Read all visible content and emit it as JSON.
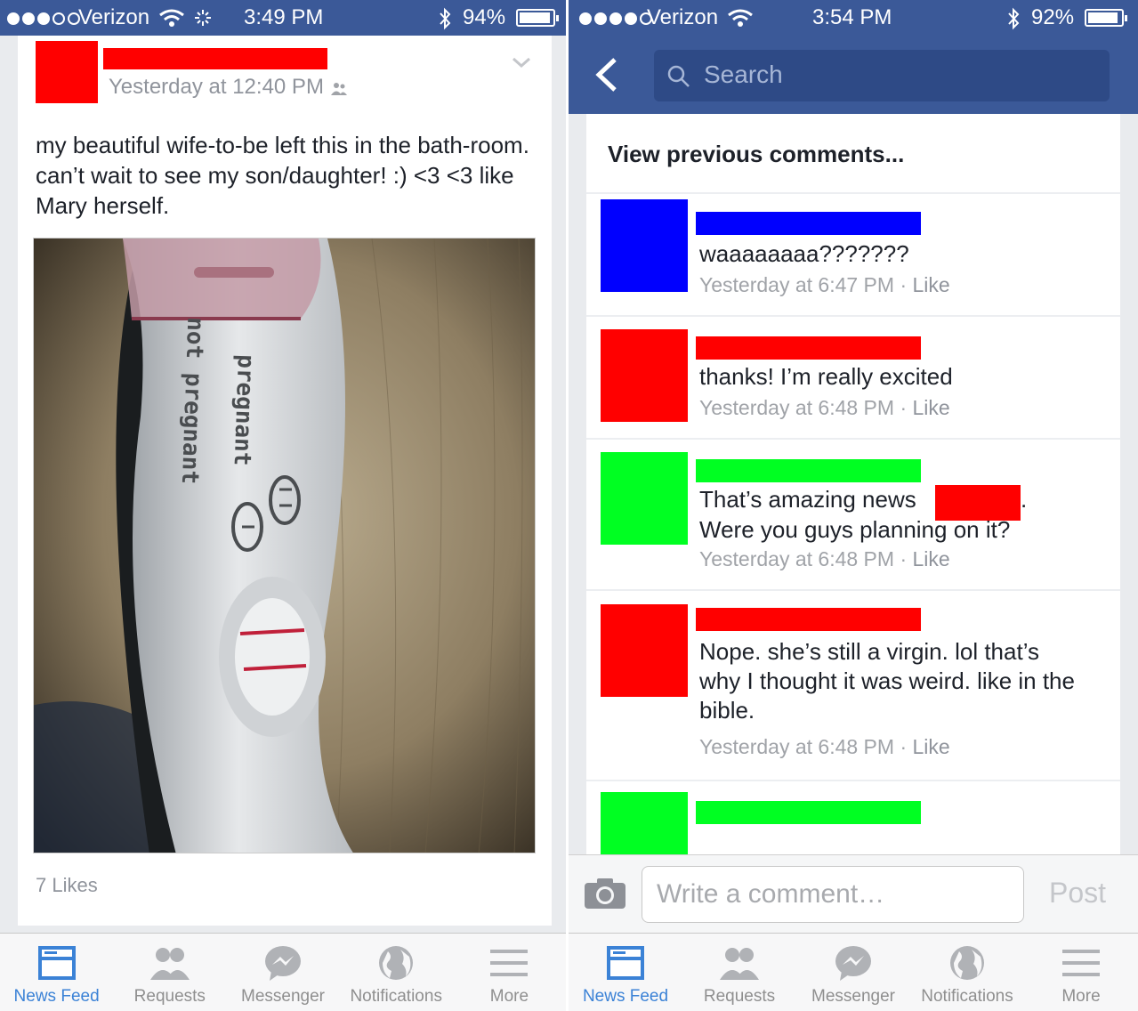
{
  "left": {
    "status": {
      "carrier": "Verizon",
      "time": "3:49 PM",
      "battery": "94%",
      "battery_level": 0.94
    },
    "post": {
      "time": "Yesterday at 12:40 PM",
      "text": "my beautiful wife-to-be left this in the bath-room. can’t wait to see my son/daughter! :) <3 <3 like Mary herself.",
      "photo_labels": {
        "pregnant": "pregnant",
        "not_pregnant": "not pregnant"
      },
      "likes": "7 Likes"
    }
  },
  "right": {
    "status": {
      "carrier": "Verizon",
      "time": "3:54 PM",
      "battery": "92%",
      "battery_level": 0.92
    },
    "search_placeholder": "Search",
    "view_previous": "View previous comments...",
    "comments": [
      {
        "text": "waaaaaaaa???????",
        "time": "Yesterday at 6:47 PM",
        "like": "Like",
        "color": "#0000ff"
      },
      {
        "text": "thanks! I’m really excited",
        "time": "Yesterday at 6:48 PM",
        "like": "Like",
        "color": "#ff0000"
      },
      {
        "text_a": "That’s amazing news",
        "text_b": ".",
        "text_c": "Were you guys planning on it?",
        "time": "Yesterday at 6:48 PM",
        "like": "Like",
        "color": "#00ff22"
      },
      {
        "text": "Nope. she’s still a virgin. lol that’s why I thought it was weird. like in the bible.",
        "time": "Yesterday at 6:48 PM",
        "like": "Like",
        "color": "#ff0000"
      },
      {
        "color": "#00ff22"
      }
    ],
    "composer": {
      "placeholder": "Write a comment…",
      "post_label": "Post"
    }
  },
  "tabs": [
    {
      "label": "News Feed",
      "icon": "news-feed-icon",
      "active": true
    },
    {
      "label": "Requests",
      "icon": "requests-icon"
    },
    {
      "label": "Messenger",
      "icon": "messenger-icon"
    },
    {
      "label": "Notifications",
      "icon": "globe-icon"
    },
    {
      "label": "More",
      "icon": "menu-icon"
    }
  ],
  "colors": {
    "brand": "#3b5998",
    "active_tab": "#3b82d6",
    "redact_red": "#ff0000"
  }
}
